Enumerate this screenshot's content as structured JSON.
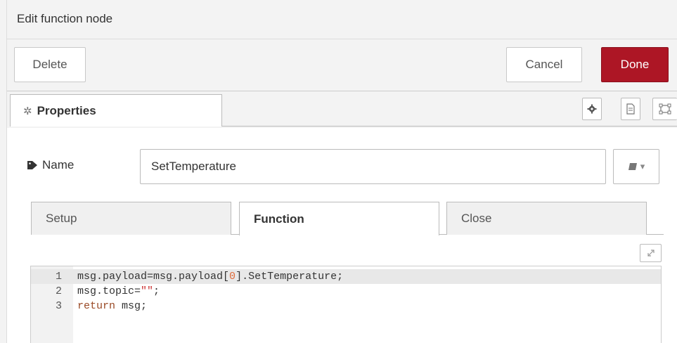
{
  "dialog": {
    "title": "Edit function node"
  },
  "toolbar": {
    "delete_label": "Delete",
    "cancel_label": "Cancel",
    "done_label": "Done"
  },
  "tabs": {
    "properties_label": "Properties",
    "icons": [
      "gear-icon",
      "description-icon",
      "appearance-icon"
    ]
  },
  "name_field": {
    "label": "Name",
    "value": "SetTemperature",
    "icon": "book-icon"
  },
  "sub_tabs": [
    {
      "label": "Setup",
      "active": false
    },
    {
      "label": "Function",
      "active": true
    },
    {
      "label": "Close",
      "active": false
    }
  ],
  "editor": {
    "line_numbers": [
      "1",
      "2",
      "3"
    ],
    "lines": {
      "l1_a": "msg.payload=msg.payload[",
      "l1_num": "0",
      "l1_b": "].SetTemperature;",
      "l2_a": "msg.topic=",
      "l2_str": "\"\"",
      "l2_b": ";",
      "l3_kw": "return",
      "l3_b": " msg;"
    }
  },
  "colors": {
    "done_button": "#ad1625",
    "header_bg": "#f3f3f3"
  }
}
